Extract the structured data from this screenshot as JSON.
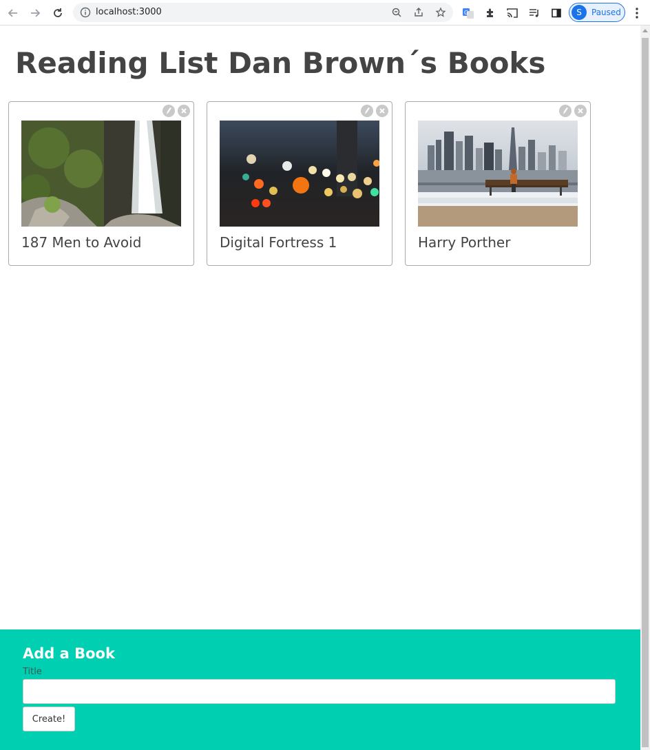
{
  "browser": {
    "url": "localhost:3000",
    "profile_initial": "S",
    "profile_status": "Paused"
  },
  "page": {
    "title": "Reading List Dan Brown´s Books"
  },
  "books": [
    {
      "title": "187 Men to Avoid",
      "image": "waterfall"
    },
    {
      "title": "Digital Fortress 1",
      "image": "bokeh-lights"
    },
    {
      "title": "Harry Porther",
      "image": "city-skyline-bench"
    }
  ],
  "form": {
    "heading": "Add a Book",
    "title_label": "Title",
    "title_value": "",
    "submit_label": "Create!"
  },
  "colors": {
    "accent": "#00cfb1",
    "title_text": "#444444"
  }
}
